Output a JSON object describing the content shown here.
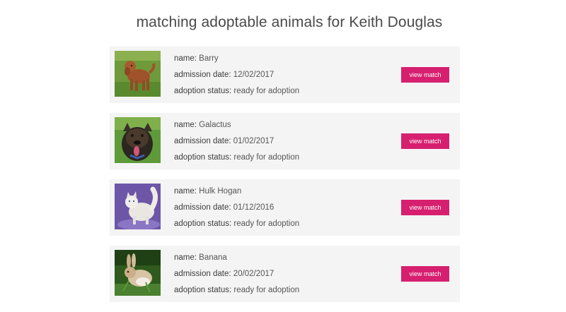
{
  "page": {
    "title": "matching adoptable animals for Keith Douglas"
  },
  "labels": {
    "name": "name:",
    "admission_date": "admission date:",
    "adoption_status": "adoption status:"
  },
  "animals": [
    {
      "name": "Barry",
      "admission_date": "12/02/2017",
      "adoption_status": "ready for adoption",
      "button": "view match",
      "photo": "brown curly dog on grass"
    },
    {
      "name": "Galactus",
      "admission_date": "01/02/2017",
      "adoption_status": "ready for adoption",
      "button": "view match",
      "photo": "dark brindle dog with tongue out on grass"
    },
    {
      "name": "Hulk Hogan",
      "admission_date": "01/12/2016",
      "adoption_status": "ready for adoption",
      "button": "view match",
      "photo": "white fluffy cat on purple background"
    },
    {
      "name": "Banana",
      "admission_date": "20/02/2017",
      "adoption_status": "ready for adoption",
      "button": "view match",
      "photo": "tan and white rabbit in grass"
    }
  ],
  "colors": {
    "accent": "#d71f6f",
    "card_bg": "#f4f4f4",
    "title_text": "#4a4a4a"
  }
}
